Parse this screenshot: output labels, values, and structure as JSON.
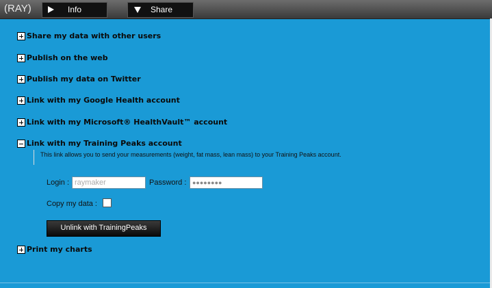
{
  "header": {
    "user": "(RAY)",
    "tabs": [
      {
        "label": "Info",
        "icon": "play-right-icon"
      },
      {
        "label": "Share",
        "icon": "triangle-down-icon"
      }
    ]
  },
  "items": [
    {
      "label": "Share my data with other users",
      "expanded": false
    },
    {
      "label": "Publish on the web",
      "expanded": false
    },
    {
      "label": "Publish my data on Twitter",
      "expanded": false
    },
    {
      "label": "Link with my Google Health account",
      "expanded": false
    },
    {
      "label": "Link with my Microsoft® HealthVault™ account",
      "expanded": false
    },
    {
      "label": "Link with my Training Peaks account",
      "expanded": true
    },
    {
      "label": "Print my charts",
      "expanded": false
    }
  ],
  "training_peaks": {
    "description": "This link allows you to send your measurements (weight, fat mass, lean mass) to your Training Peaks account.",
    "login_label": "Login :",
    "login_value": "raymaker",
    "password_label": "Password :",
    "password_value": "●●●●●●●●",
    "copy_label": "Copy my data :",
    "unlink_label": "Unlink with TrainingPeaks"
  },
  "colors": {
    "background": "#1a9ad6",
    "topbar": "#4a4a4a"
  }
}
